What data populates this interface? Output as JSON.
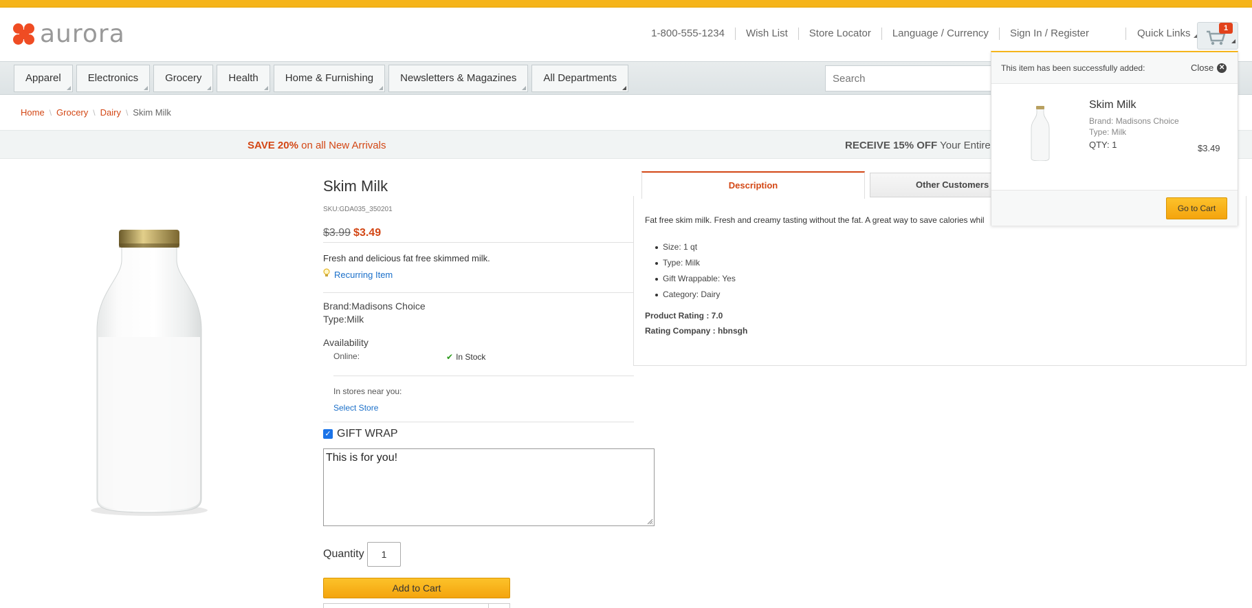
{
  "brand": {
    "name": "aurora"
  },
  "header": {
    "phone": "1-800-555-1234",
    "wish_list": "Wish List",
    "store_locator": "Store Locator",
    "language_currency": "Language / Currency",
    "sign_in": "Sign In / Register",
    "quick_links": "Quick Links",
    "cart_count": "1",
    "cart_icon": "cart-icon"
  },
  "nav": {
    "items": [
      "Apparel",
      "Electronics",
      "Grocery",
      "Health",
      "Home & Furnishing",
      "Newsletters & Magazines",
      "All Departments"
    ],
    "search_placeholder": "Search"
  },
  "breadcrumb": {
    "home": "Home",
    "grocery": "Grocery",
    "dairy": "Dairy",
    "current": "Skim Milk"
  },
  "promo": {
    "left_bold": "SAVE 20%",
    "left_rest": " on all New Arrivals",
    "right_bold": "RECEIVE 15% OFF",
    "right_rest": " Your Entire"
  },
  "product": {
    "name": "Skim Milk",
    "sku": "SKU:GDA035_350201",
    "old_price": "$3.99",
    "price": "$3.49",
    "short_description": "Fresh and delicious fat free skimmed milk.",
    "recurring": "Recurring Item",
    "brand_line": "Brand:Madisons Choice",
    "type_line": "Type:Milk",
    "availability_title": "Availability",
    "online_label": "Online:",
    "in_stock": "In Stock",
    "stores_label": "In stores near you:",
    "select_store": "Select Store",
    "gift_wrap_label": "GIFT WRAP",
    "gift_wrap_checked": true,
    "gift_message": "This is for you!",
    "quantity_label": "Quantity",
    "quantity": "1",
    "add_to_cart": "Add to Cart"
  },
  "tabs": {
    "description": "Description",
    "other": "Other Customers A",
    "desc_text": "Fat free skim milk. Fresh and creamy tasting without the fat. A great way to save calories whil",
    "attributes": [
      "Size: 1 qt",
      "Type: Milk",
      "Gift Wrappable: Yes",
      "Category: Dairy"
    ],
    "product_rating": "Product Rating : 7.0",
    "rating_company": "Rating Company : hbnsgh"
  },
  "popup": {
    "message": "This item has been successfully added:",
    "close": "Close",
    "item_name": "Skim Milk",
    "item_brand": "Brand: Madisons Choice",
    "item_type": "Type: Milk",
    "item_qty": "QTY: 1",
    "item_price": "$3.49",
    "go_to_cart": "Go to Cart"
  },
  "colors": {
    "accent": "#f5b41a",
    "brand_red": "#d34715",
    "link_blue": "#1a6fc9"
  }
}
